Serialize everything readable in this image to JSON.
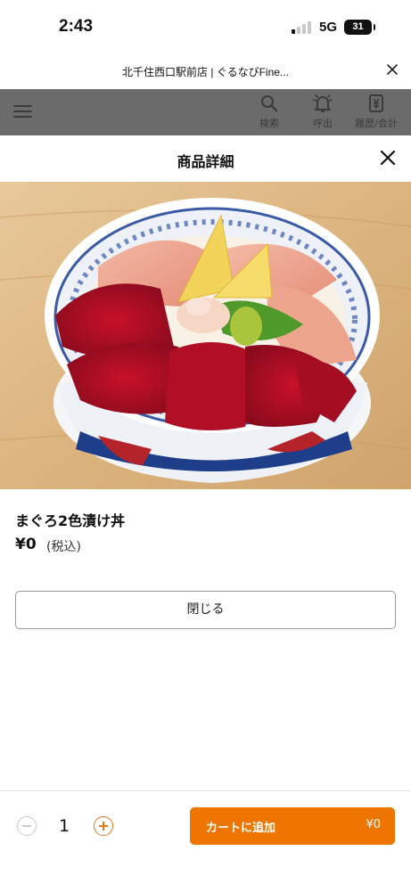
{
  "status_bar": {
    "time": "2:43",
    "network": "5G",
    "battery": "31"
  },
  "browser": {
    "title": "北千住西口駅前店 | ぐるなびFine..."
  },
  "header": {
    "items": [
      {
        "label": "検索",
        "icon": "search-icon"
      },
      {
        "label": "呼出",
        "icon": "bell-icon"
      },
      {
        "label": "履歴/会計",
        "icon": "receipt-icon"
      }
    ]
  },
  "modal": {
    "title": "商品詳細"
  },
  "product": {
    "name": "まぐろ2色漬け丼",
    "price": "¥0",
    "tax_note": "(税込)",
    "image": "tuna-bowl-photo"
  },
  "buttons": {
    "close_label": "閉じる"
  },
  "order": {
    "quantity": "1",
    "cart_label": "カートに追加",
    "cart_price": "¥0"
  },
  "colors": {
    "accent": "#ee7600",
    "header_bg": "#6b6b6b"
  }
}
